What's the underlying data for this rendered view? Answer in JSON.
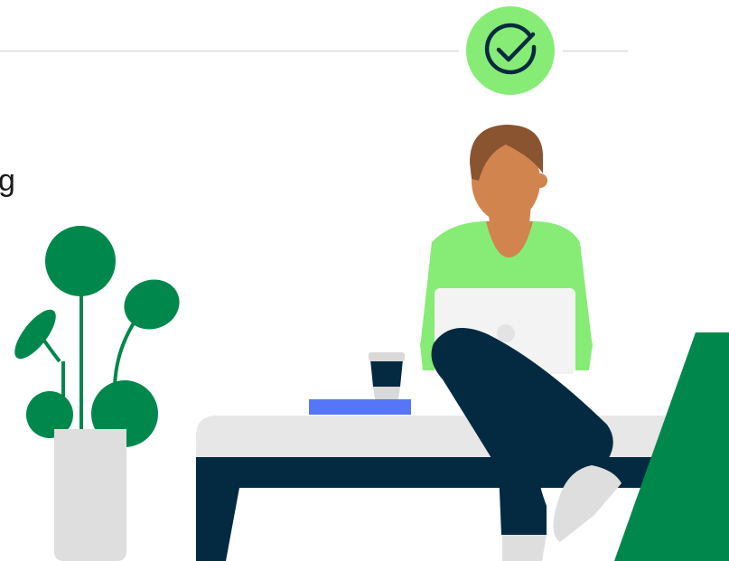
{
  "text_fragment": "g",
  "colors": {
    "background": "#ffffff",
    "divider": "#d9d9d9",
    "check_circle": "#86ec75",
    "check_stroke": "#032a40",
    "hair": "#8a5431",
    "skin": "#d2844f",
    "shirt": "#86ec75",
    "laptop": "#f3f3f3",
    "laptop_logo": "#e3e3e3",
    "pants": "#032a40",
    "shoes": "#dedede",
    "bench_top": "#e7e7e7",
    "bench_frame": "#032a40",
    "book": "#5577f7",
    "cup_body": "#032a40",
    "cup_lid": "#d9d9d9",
    "plant_leaf": "#00884c",
    "pot": "#dedede",
    "green_shape": "#00884c"
  },
  "icons": {
    "status": "check-circle-icon"
  }
}
